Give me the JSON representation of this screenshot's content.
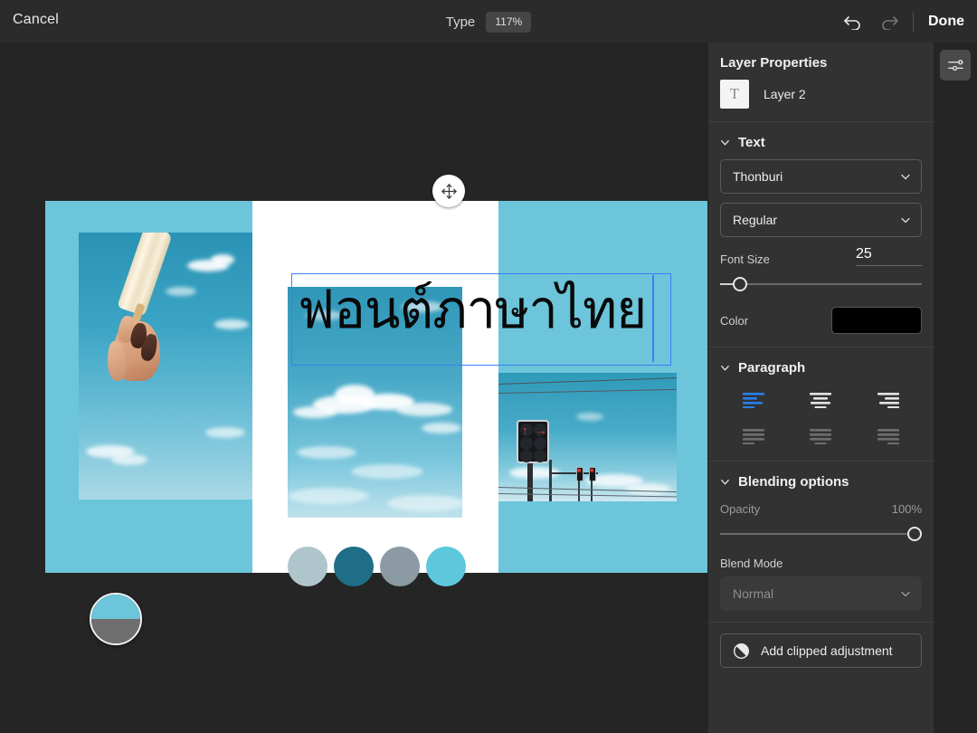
{
  "topbar": {
    "cancel_label": "Cancel",
    "title": "Type",
    "zoom_level": "117%",
    "undo_icon": "undo-icon",
    "redo_icon": "redo-icon",
    "done_label": "Done"
  },
  "rail": {
    "settings_icon": "sliders-icon"
  },
  "panel": {
    "title": "Layer Properties",
    "layer": {
      "thumb_glyph": "T",
      "name": "Layer 2"
    },
    "text_section": {
      "heading": "Text",
      "font_family": "Thonburi",
      "font_style": "Regular",
      "font_size_label": "Font Size",
      "font_size_value": "25",
      "font_size_percent": 10,
      "color_label": "Color",
      "color_value": "#000000"
    },
    "paragraph_section": {
      "heading": "Paragraph",
      "alignments": [
        {
          "name": "align-left",
          "state": "active"
        },
        {
          "name": "align-center",
          "state": "normal"
        },
        {
          "name": "align-right",
          "state": "normal"
        },
        {
          "name": "justify-left",
          "state": "disabled"
        },
        {
          "name": "justify-center",
          "state": "disabled"
        },
        {
          "name": "justify-right",
          "state": "disabled"
        }
      ],
      "active_color": "#2680eb"
    },
    "blending_section": {
      "heading": "Blending options",
      "opacity_label": "Opacity",
      "opacity_value": "100%",
      "opacity_percent": 100,
      "blend_mode_label": "Blend Mode",
      "blend_mode_value": "Normal"
    },
    "clipped_adjustment": {
      "label": "Add clipped adjustment",
      "icon": "adjustment-circle-icon"
    }
  },
  "canvas": {
    "text_layer": {
      "content": "ฟอนต์ภาษาไทย",
      "color": "#08090a"
    },
    "move_handle_icon": "move-handle-icon",
    "color_loupe": {
      "top_color": "#6cc5da",
      "bottom_color": "#6e6e6e"
    },
    "artboard_bg": "#6cc5da",
    "panel_bg": "#ffffff",
    "swatches": [
      {
        "name": "swatch-1",
        "color": "#afc5cc"
      },
      {
        "name": "swatch-2",
        "color": "#1e6e87"
      },
      {
        "name": "swatch-3",
        "color": "#8c9ba3"
      },
      {
        "name": "swatch-4",
        "color": "#5dc8dc"
      }
    ],
    "photos": [
      {
        "name": "photo-popsicle-hand",
        "subject": "hand holding popsicle against blue sky"
      },
      {
        "name": "photo-clouds",
        "subject": "clouds in blue sky"
      },
      {
        "name": "photo-traffic-light",
        "subject": "traffic lights with red arrows and power lines"
      }
    ]
  }
}
